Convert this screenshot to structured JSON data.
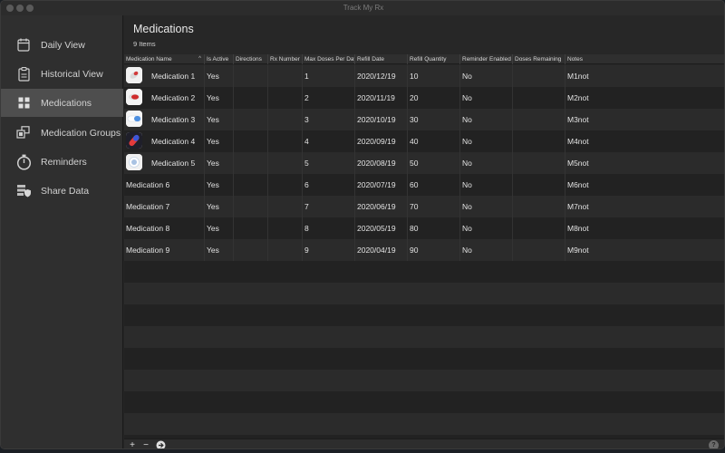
{
  "window": {
    "title": "Track My Rx"
  },
  "sidebar": {
    "items": [
      {
        "label": "Daily View",
        "icon": "calendar-icon"
      },
      {
        "label": "Historical View",
        "icon": "clipboard-icon"
      },
      {
        "label": "Medications",
        "icon": "grid-icon",
        "active": true
      },
      {
        "label": "Medication Groups",
        "icon": "groups-icon"
      },
      {
        "label": "Reminders",
        "icon": "stopwatch-icon"
      },
      {
        "label": "Share Data",
        "icon": "shield-icon"
      }
    ]
  },
  "main": {
    "title": "Medications",
    "count_label": "9 Items"
  },
  "table": {
    "columns": [
      "Medication Name",
      "Is Active",
      "Directions",
      "Rx Number",
      "Max Doses Per Day",
      "Refill Date",
      "Refill Quantity",
      "Reminder Enabled",
      "Doses Remaining",
      "Notes"
    ],
    "rows": [
      {
        "name": "Medication 1",
        "active": "Yes",
        "directions": "",
        "rx": "",
        "max": "1",
        "refill_date": "2020/12/19",
        "qty": "10",
        "reminder": "No",
        "remaining": "",
        "notes": "M1not",
        "icon": "pill-red-white-icon"
      },
      {
        "name": "Medication 2",
        "active": "Yes",
        "directions": "",
        "rx": "",
        "max": "2",
        "refill_date": "2020/11/19",
        "qty": "20",
        "reminder": "No",
        "remaining": "",
        "notes": "M2not",
        "icon": "pill-red-icon"
      },
      {
        "name": "Medication 3",
        "active": "Yes",
        "directions": "",
        "rx": "",
        "max": "3",
        "refill_date": "2020/10/19",
        "qty": "30",
        "reminder": "No",
        "remaining": "",
        "notes": "M3not",
        "icon": "capsule-blue-icon"
      },
      {
        "name": "Medication 4",
        "active": "Yes",
        "directions": "",
        "rx": "",
        "max": "4",
        "refill_date": "2020/09/19",
        "qty": "40",
        "reminder": "No",
        "remaining": "",
        "notes": "M4not",
        "icon": "capsule-red-blue-icon"
      },
      {
        "name": "Medication 5",
        "active": "Yes",
        "directions": "",
        "rx": "",
        "max": "5",
        "refill_date": "2020/08/19",
        "qty": "50",
        "reminder": "No",
        "remaining": "",
        "notes": "M5not",
        "icon": "tablet-white-icon"
      },
      {
        "name": "Medication 6",
        "active": "Yes",
        "directions": "",
        "rx": "",
        "max": "6",
        "refill_date": "2020/07/19",
        "qty": "60",
        "reminder": "No",
        "remaining": "",
        "notes": "M6not"
      },
      {
        "name": "Medication 7",
        "active": "Yes",
        "directions": "",
        "rx": "",
        "max": "7",
        "refill_date": "2020/06/19",
        "qty": "70",
        "reminder": "No",
        "remaining": "",
        "notes": "M7not"
      },
      {
        "name": "Medication 8",
        "active": "Yes",
        "directions": "",
        "rx": "",
        "max": "8",
        "refill_date": "2020/05/19",
        "qty": "80",
        "reminder": "No",
        "remaining": "",
        "notes": "M8not"
      },
      {
        "name": "Medication 9",
        "active": "Yes",
        "directions": "",
        "rx": "",
        "max": "9",
        "refill_date": "2020/04/19",
        "qty": "90",
        "reminder": "No",
        "remaining": "",
        "notes": "M9not"
      }
    ]
  },
  "bottombar": {
    "add_label": "+",
    "remove_label": "−",
    "go_label": "➔",
    "help_label": "?"
  }
}
